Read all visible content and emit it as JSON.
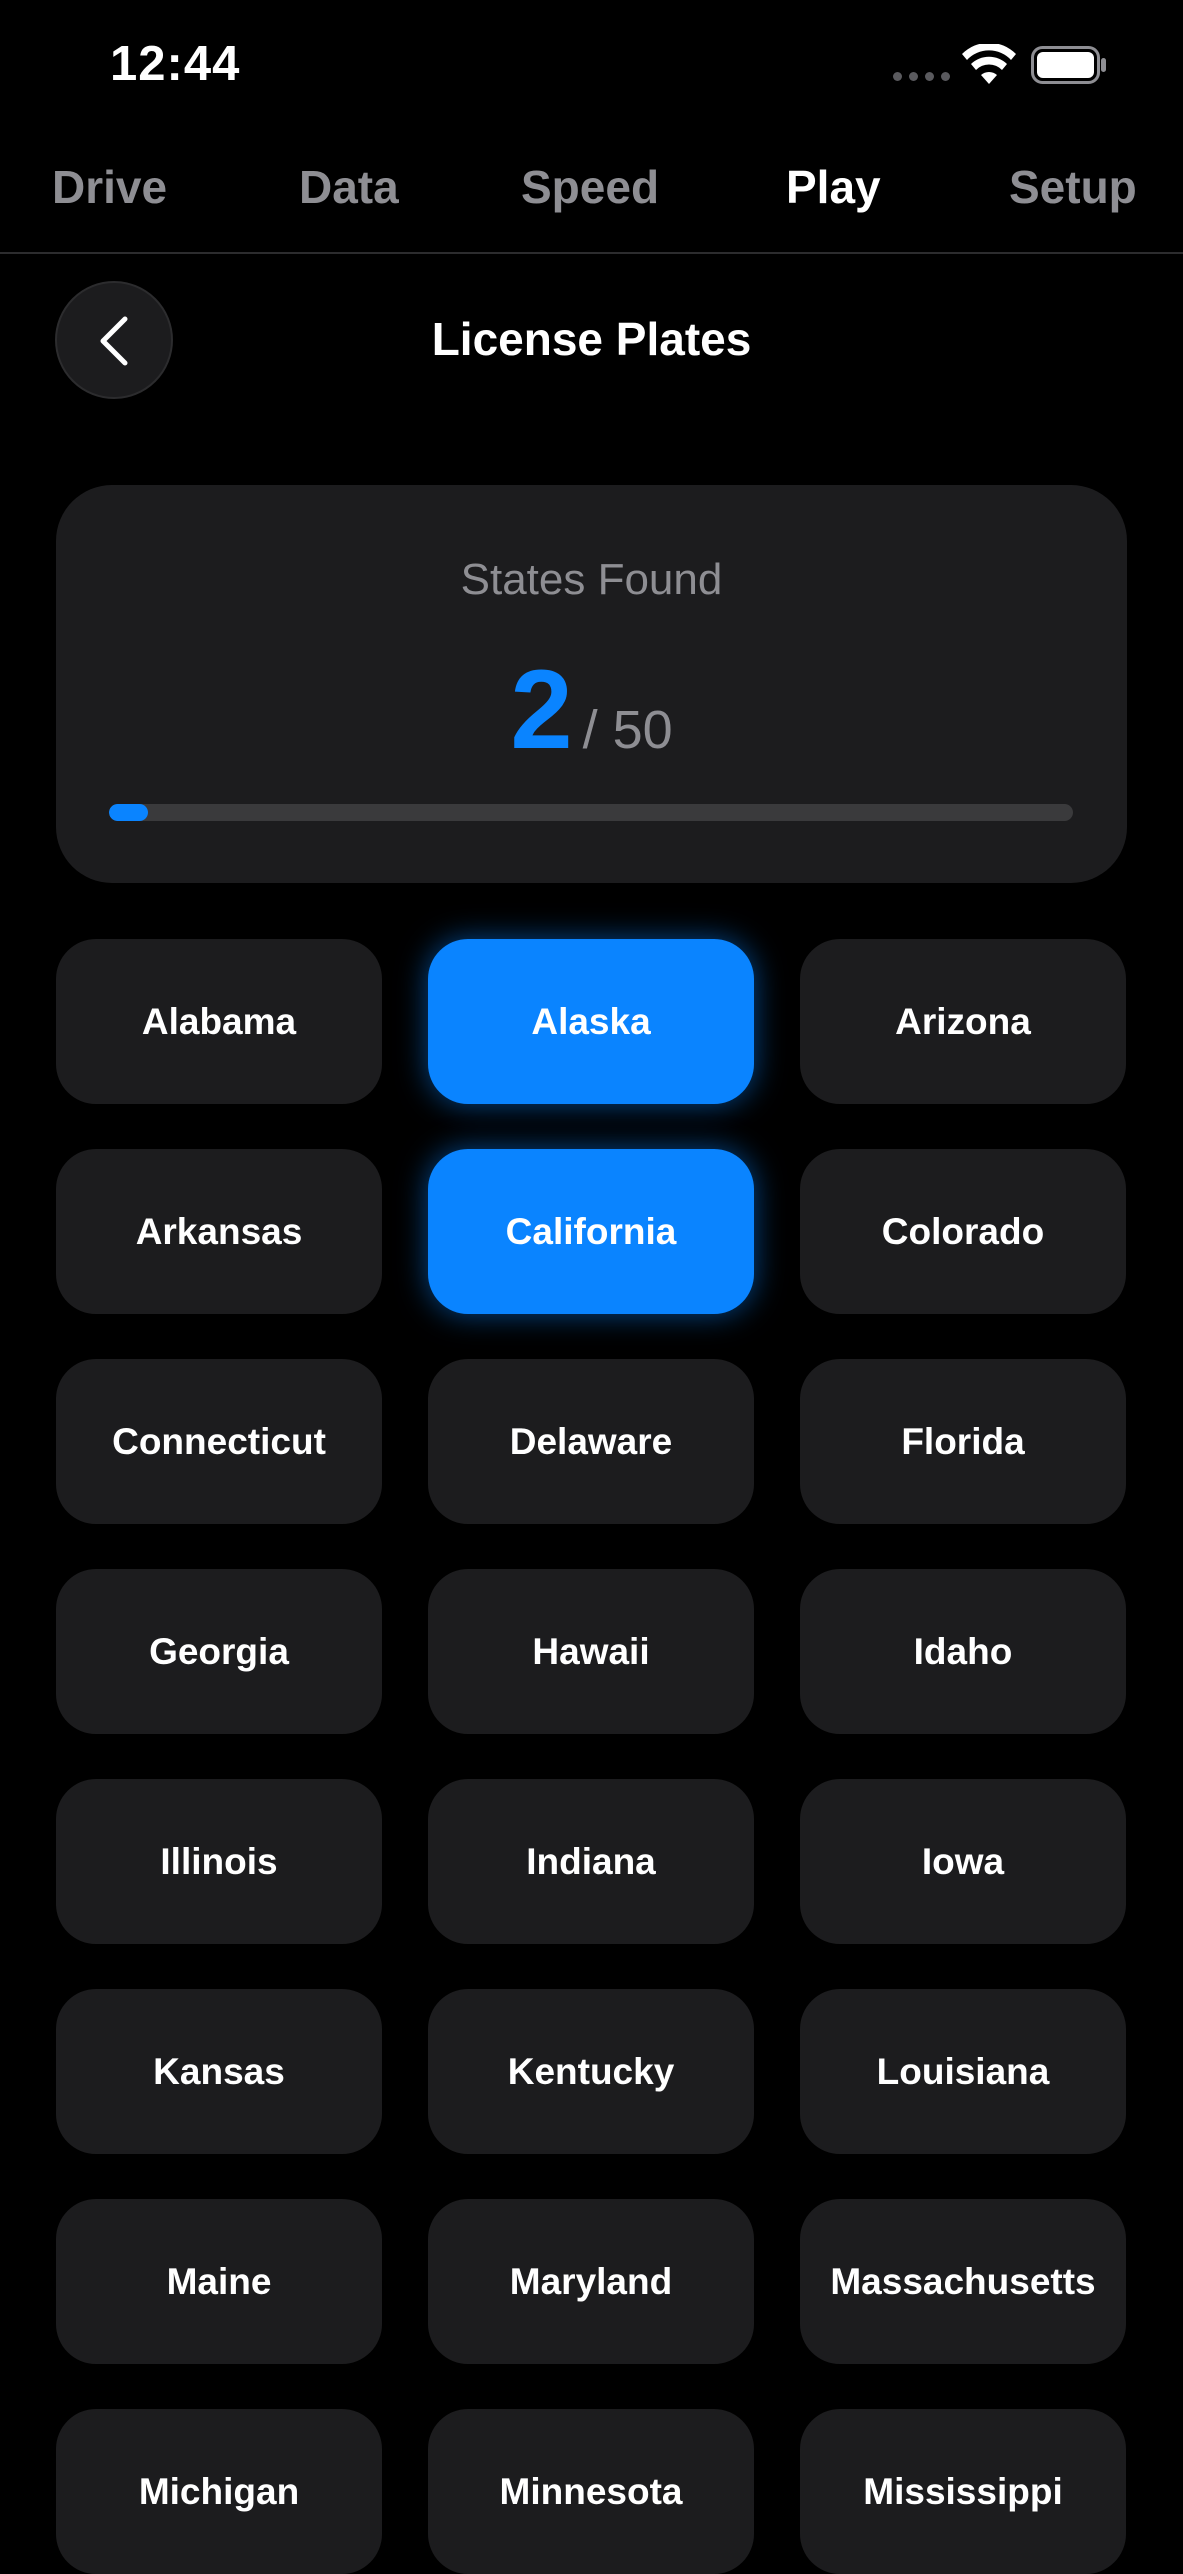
{
  "status_bar": {
    "time": "12:44",
    "icons": [
      "cellular-signal-icon",
      "wifi-icon",
      "battery-icon"
    ]
  },
  "tabs": [
    {
      "label": "Drive",
      "active": false
    },
    {
      "label": "Data",
      "active": false
    },
    {
      "label": "Speed",
      "active": false
    },
    {
      "label": "Play",
      "active": true
    },
    {
      "label": "Setup",
      "active": false
    }
  ],
  "header": {
    "title": "License Plates",
    "back_icon": "chevron-left-icon"
  },
  "progress": {
    "label": "States Found",
    "found": "2",
    "total": "/ 50",
    "fraction": 0.04
  },
  "colors": {
    "accent": "#0a84ff",
    "card": "#1c1c1e",
    "background": "#000000",
    "muted_text": "#8e8e93"
  },
  "states": [
    {
      "name": "Alabama",
      "found": false
    },
    {
      "name": "Alaska",
      "found": true
    },
    {
      "name": "Arizona",
      "found": false
    },
    {
      "name": "Arkansas",
      "found": false
    },
    {
      "name": "California",
      "found": true
    },
    {
      "name": "Colorado",
      "found": false
    },
    {
      "name": "Connecticut",
      "found": false
    },
    {
      "name": "Delaware",
      "found": false
    },
    {
      "name": "Florida",
      "found": false
    },
    {
      "name": "Georgia",
      "found": false
    },
    {
      "name": "Hawaii",
      "found": false
    },
    {
      "name": "Idaho",
      "found": false
    },
    {
      "name": "Illinois",
      "found": false
    },
    {
      "name": "Indiana",
      "found": false
    },
    {
      "name": "Iowa",
      "found": false
    },
    {
      "name": "Kansas",
      "found": false
    },
    {
      "name": "Kentucky",
      "found": false
    },
    {
      "name": "Louisiana",
      "found": false
    },
    {
      "name": "Maine",
      "found": false
    },
    {
      "name": "Maryland",
      "found": false
    },
    {
      "name": "Massachusetts",
      "found": false
    },
    {
      "name": "Michigan",
      "found": false
    },
    {
      "name": "Minnesota",
      "found": false
    },
    {
      "name": "Mississippi",
      "found": false
    }
  ]
}
